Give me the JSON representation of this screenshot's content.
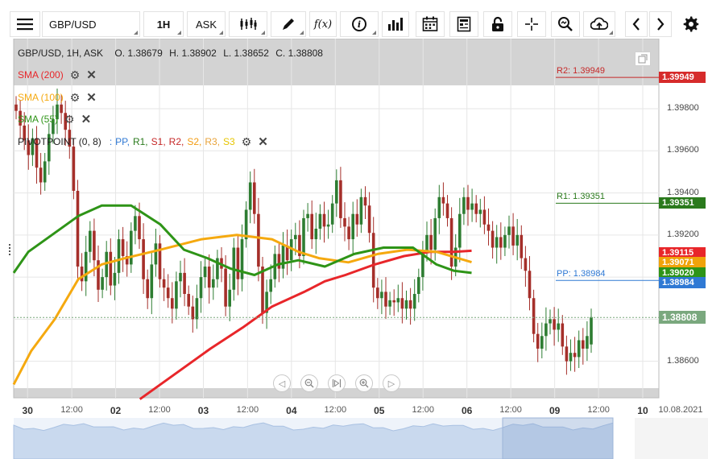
{
  "toolbar": {
    "symbol": "GBP/USD",
    "timeframe": "1H",
    "price_type": "ASK",
    "icons": [
      "menu-icon",
      "candles-icon",
      "draw-icon",
      "fx-icon",
      "info-icon",
      "bar-chart-icon",
      "calendar-icon",
      "news-icon",
      "lock-icon",
      "crosshair-icon",
      "zoom-icon",
      "upload-icon",
      "chevron-left-icon",
      "chevron-right-icon",
      "gear-icon"
    ],
    "fx_label": "f(x)",
    "info_label": "i"
  },
  "header": {
    "instrument": "GBP/USD, 1H, ASK",
    "open": "O. 1.38679",
    "high": "H. 1.38902",
    "low": "L. 1.38652",
    "close": "C. 1.38808"
  },
  "indicators": [
    {
      "label": "SMA (200)",
      "color": "#e8262a"
    },
    {
      "label": "SMA (100)",
      "color": "#f5a90f"
    },
    {
      "label": "SMA (55)",
      "color": "#2e9417"
    }
  ],
  "pivot": {
    "label": "PIVOTPOINT (0, 8)",
    "sep": ":",
    "parts": [
      {
        "t": "PP,",
        "c": "#2f79d4"
      },
      {
        "t": "R1,",
        "c": "#2a7a1c"
      },
      {
        "t": "S1,",
        "c": "#c62828"
      },
      {
        "t": "R2,",
        "c": "#c62828"
      },
      {
        "t": "S2,",
        "c": "#f39c12"
      },
      {
        "t": "R3,",
        "c": "#e8a33a"
      },
      {
        "t": "S3",
        "c": "#e7c600"
      }
    ]
  },
  "chart_data": {
    "type": "line",
    "title": "GBP/USD, 1H, ASK",
    "ylim": [
      1.3848,
      1.3998
    ],
    "yticks": [
      1.386,
      1.388,
      1.39,
      1.392,
      1.394,
      1.396,
      1.398
    ],
    "ytick_labels": [
      "1.38600",
      "1.38800",
      "1.39000",
      "1.39200",
      "1.39400",
      "1.39600",
      "1.39800"
    ],
    "x_labels": [
      {
        "t": "30",
        "bold": true,
        "pos": 0.043
      },
      {
        "t": "12:00",
        "bold": false,
        "pos": 0.18
      },
      {
        "t": "02",
        "bold": true,
        "pos": 0.316
      },
      {
        "t": "12:00",
        "bold": false,
        "pos": 0.452
      },
      {
        "t": "03",
        "bold": true,
        "pos": 0.588
      },
      {
        "t": "12:00",
        "bold": false,
        "pos": 0.725
      },
      {
        "t": "04",
        "bold": true,
        "pos": 0.861
      },
      {
        "t": "12:00",
        "bold": false,
        "pos": 0.997
      },
      {
        "t": "05",
        "bold": true,
        "pos": 1.133
      },
      {
        "t": "12:00",
        "bold": false,
        "pos": 1.269
      },
      {
        "t": "06",
        "bold": true,
        "pos": 1.405
      },
      {
        "t": "12:00",
        "bold": false,
        "pos": 1.541
      },
      {
        "t": "09",
        "bold": true,
        "pos": 1.677
      },
      {
        "t": "12:00",
        "bold": false,
        "pos": 1.813
      },
      {
        "t": "10",
        "bold": true,
        "pos": 1.95
      },
      {
        "t": "10.08.2021",
        "bold": false,
        "pos": 2.044
      }
    ],
    "grid": true,
    "current_price": 1.38808,
    "current_price_label": "1.38808",
    "candles_close": [
      1.3979,
      1.3972,
      1.3965,
      1.3958,
      1.3966,
      1.3952,
      1.3945,
      1.3955,
      1.3968,
      1.3975,
      1.3982,
      1.3978,
      1.397,
      1.3962,
      1.3941,
      1.3905,
      1.3898,
      1.3912,
      1.3922,
      1.3908,
      1.3894,
      1.39,
      1.3912,
      1.3896,
      1.3902,
      1.3918,
      1.391,
      1.3906,
      1.3922,
      1.3929,
      1.3918,
      1.3899,
      1.389,
      1.3906,
      1.3916,
      1.3899,
      1.3895,
      1.389,
      1.3885,
      1.3898,
      1.3902,
      1.3892,
      1.3886,
      1.388,
      1.389,
      1.39,
      1.3905,
      1.3895,
      1.3899,
      1.3909,
      1.3904,
      1.3886,
      1.3894,
      1.3914,
      1.3899,
      1.3918,
      1.3932,
      1.3945,
      1.393,
      1.3905,
      1.3883,
      1.3893,
      1.3899,
      1.3911,
      1.3904,
      1.3915,
      1.3908,
      1.3918,
      1.392,
      1.391,
      1.3928,
      1.393,
      1.3918,
      1.3923,
      1.393,
      1.3924,
      1.3925,
      1.3935,
      1.3946,
      1.3928,
      1.3924,
      1.3918,
      1.393,
      1.3925,
      1.3938,
      1.3934,
      1.3921,
      1.3895,
      1.389,
      1.3893,
      1.3886,
      1.3889,
      1.3888,
      1.389,
      1.3885,
      1.3889,
      1.3885,
      1.3892,
      1.39,
      1.3912,
      1.392,
      1.3913,
      1.3928,
      1.3938,
      1.3935,
      1.3928,
      1.3905,
      1.3914,
      1.393,
      1.3938,
      1.3932,
      1.3935,
      1.393,
      1.3932,
      1.3925,
      1.3922,
      1.3914,
      1.3919,
      1.3914,
      1.392,
      1.3924,
      1.3915,
      1.392,
      1.3909,
      1.3903,
      1.389,
      1.3873,
      1.3866,
      1.3872,
      1.3878,
      1.388,
      1.3875,
      1.3878,
      1.3867,
      1.386,
      1.3864,
      1.3862,
      1.387,
      1.3866,
      1.3872,
      1.3881
    ],
    "candles_open": [
      1.3982,
      1.3979,
      1.3972,
      1.3965,
      1.3958,
      1.3966,
      1.3952,
      1.3945,
      1.3955,
      1.3968,
      1.3975,
      1.3982,
      1.3978,
      1.397,
      1.3962,
      1.3941,
      1.3905,
      1.3898,
      1.3912,
      1.3922,
      1.3908,
      1.3894,
      1.39,
      1.3912,
      1.3896,
      1.3902,
      1.3918,
      1.391,
      1.3906,
      1.3922,
      1.3929,
      1.3918,
      1.3899,
      1.389,
      1.3906,
      1.3916,
      1.3899,
      1.3895,
      1.389,
      1.3885,
      1.3898,
      1.3902,
      1.3892,
      1.3886,
      1.388,
      1.389,
      1.39,
      1.3905,
      1.3895,
      1.3899,
      1.3909,
      1.3904,
      1.3886,
      1.3894,
      1.3914,
      1.3899,
      1.3918,
      1.3932,
      1.3945,
      1.393,
      1.3905,
      1.3883,
      1.3893,
      1.3899,
      1.3911,
      1.3904,
      1.3915,
      1.3908,
      1.3918,
      1.392,
      1.391,
      1.3928,
      1.393,
      1.3918,
      1.3923,
      1.393,
      1.3924,
      1.3925,
      1.3935,
      1.3946,
      1.3928,
      1.3924,
      1.3918,
      1.393,
      1.3925,
      1.3938,
      1.3934,
      1.3921,
      1.3895,
      1.389,
      1.3893,
      1.3886,
      1.3889,
      1.3888,
      1.389,
      1.3885,
      1.3889,
      1.3885,
      1.3892,
      1.39,
      1.3912,
      1.392,
      1.3913,
      1.3928,
      1.3938,
      1.3935,
      1.3928,
      1.3905,
      1.3914,
      1.393,
      1.3938,
      1.3932,
      1.3935,
      1.393,
      1.3932,
      1.3925,
      1.3922,
      1.3914,
      1.3919,
      1.3914,
      1.392,
      1.3924,
      1.3915,
      1.392,
      1.3909,
      1.3903,
      1.389,
      1.3873,
      1.3866,
      1.3872,
      1.3878,
      1.388,
      1.3875,
      1.3878,
      1.3867,
      1.386,
      1.3864,
      1.3862,
      1.387,
      1.3866,
      1.3868
    ],
    "sma200": [
      [
        0.43,
        1.3842
      ],
      [
        0.55,
        1.3854
      ],
      [
        0.67,
        1.3866
      ],
      [
        0.78,
        1.3876
      ],
      [
        0.88,
        1.3886
      ],
      [
        0.99,
        1.3893
      ],
      [
        1.06,
        1.3898
      ],
      [
        1.13,
        1.3901
      ],
      [
        1.23,
        1.3906
      ],
      [
        1.33,
        1.391
      ],
      [
        1.42,
        1.3912
      ],
      [
        1.5,
        1.3912
      ],
      [
        1.56,
        1.39125
      ]
    ],
    "sma100": [
      [
        0.0,
        1.3849
      ],
      [
        0.06,
        1.3865
      ],
      [
        0.14,
        1.388
      ],
      [
        0.22,
        1.3899
      ],
      [
        0.3,
        1.3906
      ],
      [
        0.38,
        1.3909
      ],
      [
        0.5,
        1.3913
      ],
      [
        0.64,
        1.3918
      ],
      [
        0.76,
        1.392
      ],
      [
        0.88,
        1.3918
      ],
      [
        0.97,
        1.3912
      ],
      [
        1.04,
        1.3909
      ],
      [
        1.14,
        1.3907
      ],
      [
        1.24,
        1.3911
      ],
      [
        1.34,
        1.3913
      ],
      [
        1.44,
        1.3912
      ],
      [
        1.56,
        1.39071
      ]
    ],
    "sma55": [
      [
        0.0,
        1.3902
      ],
      [
        0.05,
        1.3912
      ],
      [
        0.13,
        1.392
      ],
      [
        0.22,
        1.3929
      ],
      [
        0.3,
        1.3934
      ],
      [
        0.4,
        1.3934
      ],
      [
        0.5,
        1.3925
      ],
      [
        0.58,
        1.3913
      ],
      [
        0.66,
        1.3909
      ],
      [
        0.74,
        1.3904
      ],
      [
        0.82,
        1.3901
      ],
      [
        0.9,
        1.3906
      ],
      [
        0.97,
        1.3908
      ],
      [
        1.06,
        1.3905
      ],
      [
        1.16,
        1.3911
      ],
      [
        1.26,
        1.3914
      ],
      [
        1.36,
        1.3914
      ],
      [
        1.44,
        1.3906
      ],
      [
        1.5,
        1.3903
      ],
      [
        1.56,
        1.3902
      ]
    ],
    "levels": [
      {
        "name": "R2",
        "value": 1.39949,
        "label": "R2: 1.39949",
        "color": "#c62828"
      },
      {
        "name": "R1",
        "value": 1.39351,
        "label": "R1: 1.39351",
        "color": "#2a7a1c"
      },
      {
        "name": "PP",
        "value": 1.38984,
        "label": "PP: 1.38984",
        "color": "#2f79d4"
      }
    ],
    "tags": [
      {
        "value": 1.39949,
        "label": "1.39949",
        "color": "#d62b2b"
      },
      {
        "value": 1.39351,
        "label": "1.39351",
        "color": "#2a7a1c"
      },
      {
        "value": 1.39115,
        "label": "1.39115",
        "color": "#e8262a"
      },
      {
        "value": 1.39071,
        "label": "1.39071",
        "color": "#f0a30a"
      },
      {
        "value": 1.3902,
        "label": "1.39020",
        "color": "#2e9417"
      },
      {
        "value": 1.38984,
        "label": "1.38984",
        "color": "#2f79d4"
      }
    ]
  },
  "colors": {
    "up": "#2e7d32",
    "down": "#a52f2a",
    "grid": "#e6e6e6",
    "current": "#7aa87e"
  }
}
